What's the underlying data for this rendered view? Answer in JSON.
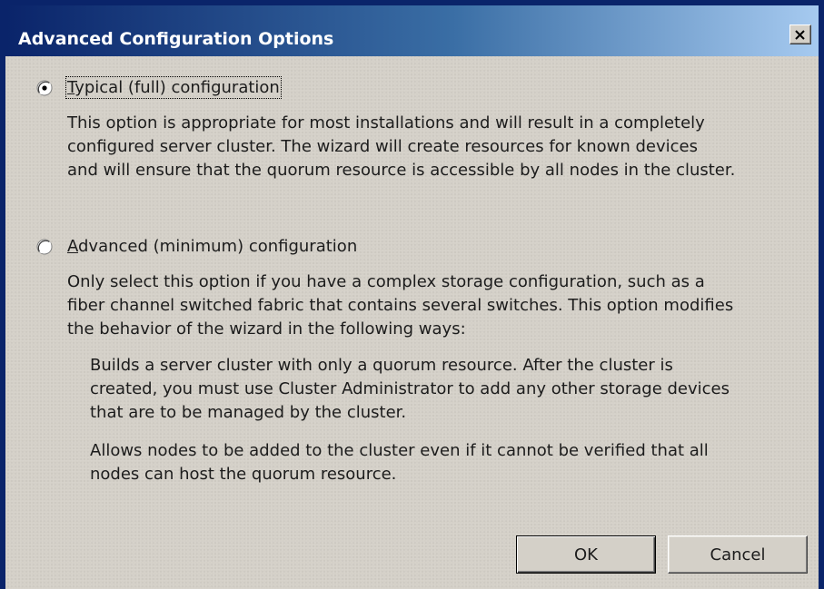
{
  "dialog": {
    "title": "Advanced Configuration Options",
    "close_icon": "close-icon"
  },
  "options": [
    {
      "label_accel": "T",
      "label_rest": "ypical (full) configuration",
      "selected": true,
      "description": [
        "This option is appropriate for most installations and will result in a completely",
        "configured server cluster. The wizard will create resources for known devices",
        "and will ensure that the quorum resource is accessible by all nodes in the cluster."
      ]
    },
    {
      "label_accel": "A",
      "label_rest": "dvanced (minimum) configuration",
      "selected": false,
      "description": [
        "Only select this option if you have a complex storage configuration, such as a",
        "fiber channel switched fabric that contains several switches. This option modifies",
        "the behavior of the wizard in the following ways:"
      ],
      "details": [
        [
          "Builds a server cluster with only a quorum resource. After the cluster is",
          "created, you must use Cluster Administrator to add any other storage devices",
          "that are to be managed by the cluster."
        ],
        [
          "Allows nodes to be added to the cluster even if it cannot be verified that all",
          "nodes can host the quorum resource."
        ]
      ]
    }
  ],
  "buttons": {
    "ok": "OK",
    "cancel": "Cancel"
  },
  "colors": {
    "title_bar_start": "#0a246a",
    "title_bar_end": "#a6caf0",
    "dialog_face": "#d4d0c8"
  }
}
